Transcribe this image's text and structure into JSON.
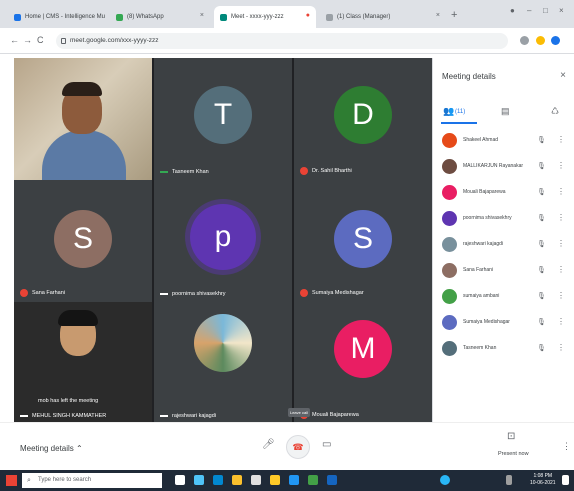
{
  "browser": {
    "tabs": [
      {
        "label": "Home | CMS - Intelligence Mu",
        "fav": "#1a73e8"
      },
      {
        "label": "(8) WhatsApp",
        "fav": "#34a853"
      },
      {
        "label": "Meet - xxxx-yyy-zzz",
        "fav": "#00897b"
      },
      {
        "label": "(1) Class (Manager)",
        "fav": "#9aa0a6"
      }
    ],
    "new_tab": "+",
    "minimize": "–",
    "maximize": "□",
    "close": "×",
    "url": "meet.google.com/xxx-yyyy-zzz",
    "back": "←",
    "forward": "→",
    "reload": "C"
  },
  "tiles": [
    {
      "name": "",
      "type": "video"
    },
    {
      "name": "Tasneem Khan",
      "letter": "T",
      "color": "#546e7a"
    },
    {
      "name": "Dr. Sahil Bharthi",
      "letter": "D",
      "color": "#2e7d32"
    },
    {
      "name": "Sana Farhani",
      "letter": "S",
      "color": "#8d6e63"
    },
    {
      "name": "poornima shivasekhry",
      "letter": "p",
      "color": "#5e35b1"
    },
    {
      "name": "Sumaiya Medishagar",
      "letter": "S",
      "color": "#5c6bc0"
    },
    {
      "name": "MEHUL SINGH KAMMATHER",
      "type": "selfie",
      "message": "mob has left the meeting"
    },
    {
      "name": "rajeshwari kajagdi",
      "type": "art"
    },
    {
      "name": "Mouali Bajaparewa",
      "letter": "M",
      "color": "#e91e63"
    }
  ],
  "panel": {
    "title": "Meeting details",
    "close": "×",
    "people_count": "(11)",
    "tabs": [
      "people",
      "chat",
      "activities"
    ],
    "people": [
      {
        "name": "Shakeel Ahmad",
        "color": "#e64a19"
      },
      {
        "name": "MALLIKARJUN Rayanakar",
        "color": "#6d4c41"
      },
      {
        "name": "Mouali Bajaparewa",
        "color": "#e91e63"
      },
      {
        "name": "poornima shivasekhry",
        "color": "#5e35b1"
      },
      {
        "name": "rajeshwari kajagdi",
        "color": "#78909c"
      },
      {
        "name": "Sana Farhani",
        "color": "#8d6e63"
      },
      {
        "name": "sumaiya ambani",
        "color": "#43a047"
      },
      {
        "name": "Sumaiya Medishagar",
        "color": "#5c6bc0"
      },
      {
        "name": "Tasneem Khan",
        "color": "#546e7a"
      }
    ]
  },
  "controls": {
    "meeting_details": "Meeting details ⌃",
    "mic": "🎤",
    "hangup": "☎",
    "camera": "▭",
    "leave_tooltip": "Leave call",
    "present": "⊡",
    "present_label": "Present now",
    "more": "⋮"
  },
  "taskbar": {
    "search_placeholder": "Type here to search",
    "time": "1:08 PM",
    "date": "10-06-2021"
  }
}
